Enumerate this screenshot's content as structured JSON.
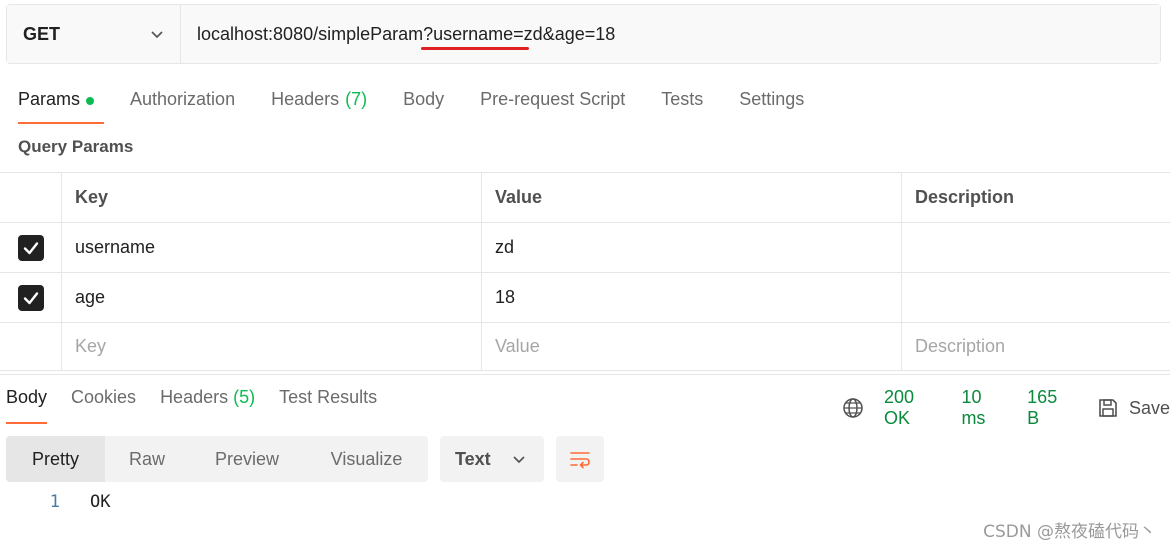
{
  "request": {
    "method": "GET",
    "url": "localhost:8080/simpleParam?username=zd&age=18"
  },
  "request_tabs": {
    "params": "Params",
    "authorization": "Authorization",
    "headers": "Headers",
    "headers_count": "(7)",
    "body": "Body",
    "prerequest": "Pre-request Script",
    "tests": "Tests",
    "settings": "Settings"
  },
  "query_params": {
    "title": "Query Params",
    "columns": {
      "key": "Key",
      "value": "Value",
      "description": "Description"
    },
    "rows": [
      {
        "key": "username",
        "value": "zd",
        "description": ""
      },
      {
        "key": "age",
        "value": "18",
        "description": ""
      }
    ],
    "placeholder": {
      "key": "Key",
      "value": "Value",
      "description": "Description"
    }
  },
  "response_tabs": {
    "body": "Body",
    "cookies": "Cookies",
    "headers": "Headers",
    "headers_count": "(5)",
    "test_results": "Test Results"
  },
  "response_meta": {
    "status": "200 OK",
    "time": "10 ms",
    "size": "165 B",
    "save": "Save"
  },
  "format": {
    "pretty": "Pretty",
    "raw": "Raw",
    "preview": "Preview",
    "visualize": "Visualize",
    "type": "Text"
  },
  "response_body": {
    "line_number": "1",
    "text": "OK"
  },
  "watermark": "CSDN @熬夜磕代码丶",
  "colors": {
    "accent": "#ff6c37",
    "green": "#0cbb52",
    "status_green": "#0a8a3c",
    "underline_red": "#e02020"
  }
}
